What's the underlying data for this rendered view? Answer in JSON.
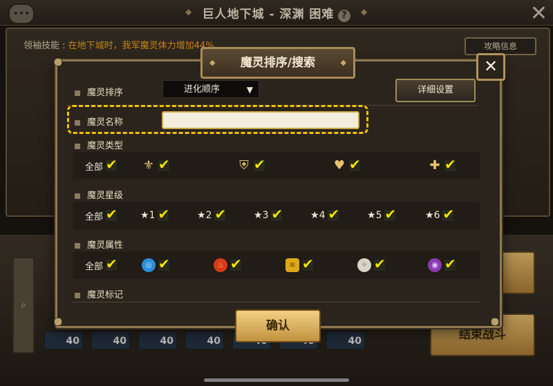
{
  "topbar": {
    "title": "巨人地下城 - 深渊 困难",
    "help": "?",
    "close": "✕"
  },
  "leader": {
    "prefix": "领袖技能 : ",
    "effect": "在地下城时，我军魔灵体力增加44%"
  },
  "strategy_button": "攻略信息",
  "side_buttons": {
    "battle": "斗",
    "end_battle": "结束战斗"
  },
  "monster_levels": [
    "40",
    "40",
    "40",
    "40",
    "40",
    "40",
    "40"
  ],
  "modal": {
    "title": "魔灵排序/搜索",
    "close": "✕",
    "sort": {
      "label": "魔灵排序",
      "value": "进化顺序",
      "detail_button": "详细设置"
    },
    "name": {
      "label": "魔灵名称",
      "value": "",
      "placeholder": ""
    },
    "type": {
      "label": "魔灵类型",
      "options": [
        {
          "label": "全部",
          "icon": "all",
          "checked": true
        },
        {
          "label": "",
          "icon": "attack-type-icon",
          "checked": true
        },
        {
          "label": "",
          "icon": "defense-type-icon",
          "checked": true
        },
        {
          "label": "",
          "icon": "hp-type-icon",
          "checked": true
        },
        {
          "label": "",
          "icon": "support-type-icon",
          "checked": true
        }
      ]
    },
    "grade": {
      "label": "魔灵星级",
      "options": [
        {
          "label": "全部",
          "checked": true
        },
        {
          "label": "1",
          "checked": true
        },
        {
          "label": "2",
          "checked": true
        },
        {
          "label": "3",
          "checked": true
        },
        {
          "label": "4",
          "checked": true
        },
        {
          "label": "5",
          "checked": true
        },
        {
          "label": "6",
          "checked": true
        }
      ]
    },
    "element": {
      "label": "魔灵属性",
      "options": [
        {
          "label": "全部",
          "checked": true
        },
        {
          "icon": "water-element-icon",
          "color": "#2a8fd8",
          "checked": true
        },
        {
          "icon": "fire-element-icon",
          "color": "#d83a1a",
          "checked": true
        },
        {
          "icon": "wind-element-icon",
          "color": "#e0a818",
          "checked": true
        },
        {
          "icon": "light-element-icon",
          "color": "#d8d4c8",
          "checked": true
        },
        {
          "icon": "dark-element-icon",
          "color": "#8a3ab0",
          "checked": true
        }
      ]
    },
    "mark": {
      "label": "魔灵标记"
    },
    "confirm": "确认"
  },
  "colors": {
    "highlight": "#f2c200",
    "check": "#f2e600",
    "leader_effect": "#f0a020"
  }
}
